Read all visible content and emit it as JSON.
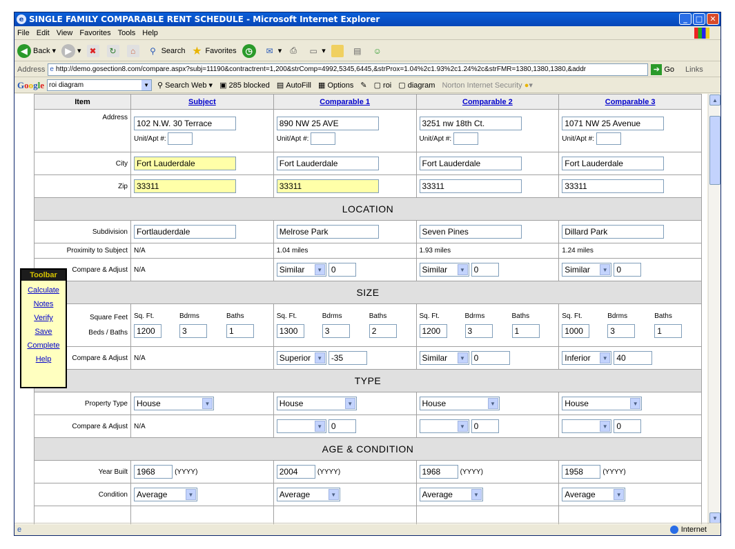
{
  "window": {
    "title": "SINGLE FAMILY COMPARABLE RENT SCHEDULE - Microsoft Internet Explorer"
  },
  "menu": [
    "File",
    "Edit",
    "View",
    "Favorites",
    "Tools",
    "Help"
  ],
  "toolbar": {
    "back": "Back",
    "search": "Search",
    "favorites": "Favorites"
  },
  "address": {
    "label": "Address",
    "url": "http://demo.gosection8.com/compare.aspx?subj=11190&contractrent=1,200&strComp=4992,5345,6445,&strProx=1.04%2c1.93%2c1.24%2c&strFMR=1380,1380,1380,&addr",
    "go": "Go",
    "links": "Links"
  },
  "google": {
    "logo": "Google",
    "query": "roi diagram",
    "search_web": "Search Web",
    "blocked": "285 blocked",
    "autofill": "AutoFill",
    "options": "Options",
    "roi": "roi",
    "diagram": "diagram",
    "norton": "Norton Internet Security"
  },
  "floating_toolbar": {
    "title": "Toolbar",
    "items": [
      "Calculate",
      "Notes",
      "Verify",
      "Save",
      "Complete",
      "Help"
    ]
  },
  "table": {
    "headers": {
      "item": "Item",
      "subject": "Subject",
      "comp1": "Comparable 1",
      "comp2": "Comparable 2",
      "comp3": "Comparable 3"
    },
    "labels": {
      "address": "Address",
      "unit": "Unit/Apt #:",
      "city": "City",
      "zip": "Zip",
      "subdivision": "Subdivision",
      "proximity": "Proximity to Subject",
      "compare": "Compare & Adjust",
      "sqft_row": "Square Feet",
      "beds_row": "Beds / Baths",
      "property_type": "Property Type",
      "year_built": "Year Built",
      "yyyy": "(YYYY)",
      "condition": "Condition",
      "sqft": "Sq. Ft.",
      "bdrms": "Bdrms",
      "baths": "Baths"
    },
    "sections": {
      "location": "LOCATION",
      "size": "SIZE",
      "type": "TYPE",
      "age": "AGE & CONDITION"
    },
    "subject": {
      "address": "102 N.W. 30 Terrace",
      "city": "Fort Lauderdale",
      "zip": "33311",
      "subdivision": "Fortlauderdale",
      "proximity": "N/A",
      "compare_loc": "N/A",
      "sqft": "1200",
      "bdrms": "3",
      "baths": "1",
      "compare_size": "N/A",
      "property_type": "House",
      "compare_type": "N/A",
      "year": "1968",
      "condition": "Average"
    },
    "comp1": {
      "address": "890 NW 25 AVE",
      "city": "Fort Lauderdale",
      "zip": "33311",
      "subdivision": "Melrose Park",
      "proximity": "1.04 miles",
      "loc_sel": "Similar",
      "loc_adj": "0",
      "sqft": "1300",
      "bdrms": "3",
      "baths": "2",
      "size_sel": "Superior",
      "size_adj": "-35",
      "property_type": "House",
      "type_sel": "",
      "type_adj": "0",
      "year": "2004",
      "condition": "Average"
    },
    "comp2": {
      "address": "3251 nw 18th Ct.",
      "city": "Fort Lauderdale",
      "zip": "33311",
      "subdivision": "Seven Pines",
      "proximity": "1.93 miles",
      "loc_sel": "Similar",
      "loc_adj": "0",
      "sqft": "1200",
      "bdrms": "3",
      "baths": "1",
      "size_sel": "Similar",
      "size_adj": "0",
      "property_type": "House",
      "type_sel": "",
      "type_adj": "0",
      "year": "1968",
      "condition": "Average"
    },
    "comp3": {
      "address": "1071 NW 25 Avenue",
      "city": "Fort Lauderdale",
      "zip": "33311",
      "subdivision": "Dillard Park",
      "proximity": "1.24 miles",
      "loc_sel": "Similar",
      "loc_adj": "0",
      "sqft": "1000",
      "bdrms": "3",
      "baths": "1",
      "size_sel": "Inferior",
      "size_adj": "40",
      "property_type": "House",
      "type_sel": "",
      "type_adj": "0",
      "year": "1958",
      "condition": "Average"
    }
  },
  "status": {
    "zone": "Internet"
  }
}
